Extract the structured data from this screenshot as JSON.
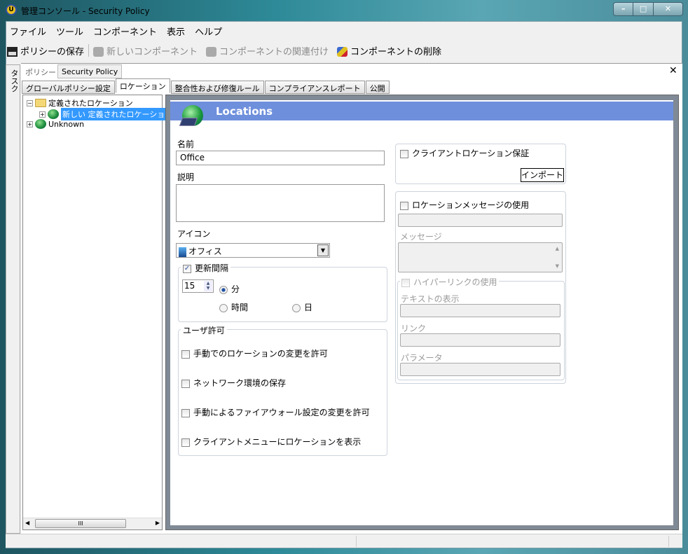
{
  "window": {
    "title": "管理コンソール - Security Policy",
    "app_icon": "shield-app-icon"
  },
  "menu": [
    "ファイル",
    "ツール",
    "コンポーネント",
    "表示",
    "ヘルプ"
  ],
  "toolbar": {
    "save": "ポリシーの保存",
    "new_component": "新しいコンポーネント",
    "associate": "コンポーネントの関連付け",
    "delete": "コンポーネントの削除"
  },
  "tasks_label": "タスク",
  "policy": {
    "label": "ポリシー",
    "name": "Security Policy"
  },
  "tabs": [
    "グローバルポリシー設定",
    "ロケーション",
    "整合性および修復ルール",
    "コンプライアンスレポート",
    "公開"
  ],
  "active_tab": 1,
  "tree": {
    "root": "定義されたロケーション",
    "child": "新しい 定義されたロケーショ",
    "unknown": "Unknown"
  },
  "panel": {
    "header": "Locations",
    "name_label": "名前",
    "name_value": "Office",
    "desc_label": "説明",
    "desc_value": "",
    "icon_label": "アイコン",
    "icon_value": "オフィス",
    "update_interval": {
      "label": "更新間隔",
      "checked": true,
      "value": "15",
      "units": [
        "分",
        "時間",
        "日"
      ],
      "selected": "分"
    },
    "user_permission": {
      "label": "ユーザ許可",
      "items": [
        "手動でのロケーションの変更を許可",
        "ネットワーク環境の保存",
        "手動によるファイアウォール設定の変更を許可",
        "クライアントメニューにロケーションを表示"
      ]
    },
    "client_assurance": {
      "label": "クライアントロケーション保証",
      "import": "インポート"
    },
    "location_message": {
      "label": "ロケーションメッセージの使用",
      "message_label": "メッセージ",
      "hyperlink": "ハイパーリンクの使用",
      "text_label": "テキストの表示",
      "link_label": "リンク",
      "param_label": "パラメータ"
    }
  },
  "scroll_thumb": "III"
}
